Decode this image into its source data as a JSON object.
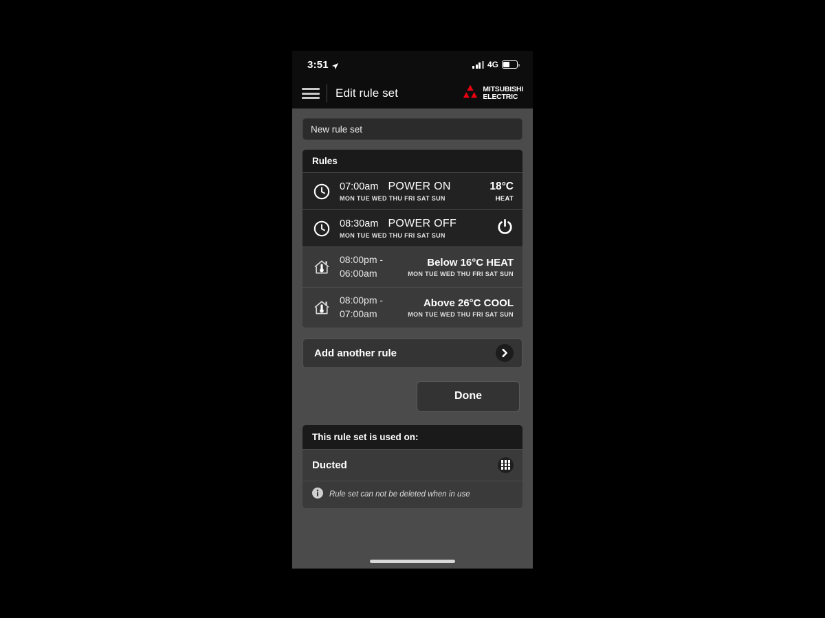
{
  "status_bar": {
    "time": "3:51",
    "location_icon": "location-arrow-icon",
    "network": "4G",
    "signal_icon": "cellular-bars-icon",
    "battery_icon": "battery-icon"
  },
  "nav": {
    "menu_icon": "hamburger-menu-icon",
    "title": "Edit rule set",
    "brand_line1": "MITSUBISHI",
    "brand_line2": "ELECTRIC",
    "brand_logo_icon": "mitsubishi-diamonds-icon",
    "brand_color": "#e60012"
  },
  "rule_set_name": {
    "value": "New rule set",
    "placeholder": "New rule set"
  },
  "rules_card": {
    "header": "Rules",
    "rules": [
      {
        "kind": "schedule",
        "icon": "clock-icon",
        "time": "07:00am",
        "action": "POWER ON",
        "days": "MON TUE WED THU FRI SAT SUN",
        "temperature": "18°C",
        "mode": "HEAT"
      },
      {
        "kind": "schedule",
        "icon": "clock-icon",
        "time": "08:30am",
        "action": "POWER OFF",
        "days": "MON TUE WED THU FRI SAT SUN",
        "right_icon": "power-icon"
      },
      {
        "kind": "temperature",
        "icon": "house-thermometer-icon",
        "time_start": "08:00pm -",
        "time_end": "06:00am",
        "condition": "Below 16°C HEAT",
        "days": "MON TUE WED THU FRI SAT SUN"
      },
      {
        "kind": "temperature",
        "icon": "house-thermometer-icon",
        "time_start": "08:00pm -",
        "time_end": "07:00am",
        "condition": "Above 26°C COOL",
        "days": "MON TUE WED THU FRI SAT SUN"
      }
    ]
  },
  "add_rule": {
    "label": "Add another rule",
    "chevron_icon": "chevron-right-icon"
  },
  "done_button": {
    "label": "Done"
  },
  "usage_card": {
    "header": "This rule set is used on:",
    "device_name": "Ducted",
    "device_icon": "grid-icon",
    "info_icon": "info-icon",
    "note": "Rule set can not be deleted when in use"
  }
}
